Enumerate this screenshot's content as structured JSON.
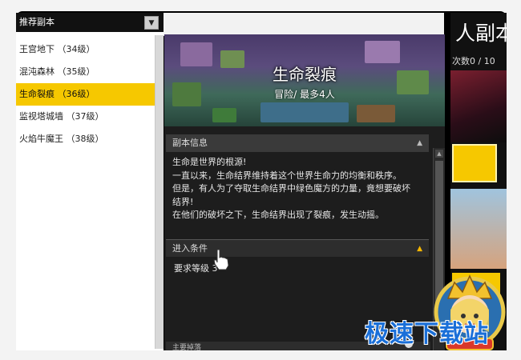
{
  "left_panel": {
    "header": "推荐副本",
    "items": [
      {
        "label": "王宫地下  （34级）"
      },
      {
        "label": "混沌森林  （35级）"
      },
      {
        "label": "生命裂痕  （36级）",
        "selected": true
      },
      {
        "label": "监视塔城墙  （37级）"
      },
      {
        "label": "火焰牛魔王  （38级）"
      }
    ]
  },
  "dungeon": {
    "title": "生命裂痕",
    "subtitle": "冒险/ 最多4人",
    "info_header": "副本信息",
    "description": [
      "生命是世界的根源!",
      "一直以来，生命结界维持着这个世界生命力的均衡和秩序。",
      "但是，有人为了夺取生命结界中绿色魔方的力量，竟想要破坏",
      "结界!",
      "在他们的破坏之下，生命结界出现了裂痕，发生动摇。"
    ],
    "conditions_header": "进入条件",
    "requirement": "要求等级 3",
    "bottom_header": "主要掉落"
  },
  "right_panel": {
    "title": "人副本",
    "count": "次数0 / 10"
  },
  "watermark": "极速下载站",
  "colors": {
    "accent": "#f6c800",
    "panel_dark": "#1d1d1d",
    "watermark": "#1a6fd8"
  },
  "icons": {
    "dropdown": "triangle-down",
    "collapse": "triangle-up",
    "cursor": "hand-pointer"
  }
}
